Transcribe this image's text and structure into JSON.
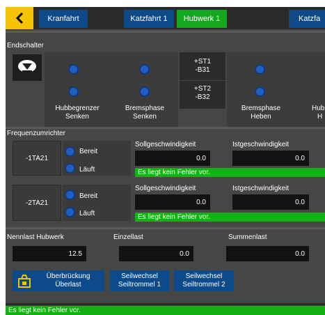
{
  "tabs": [
    {
      "label": "Kranfahrt",
      "active": false
    },
    {
      "label": "Katzfahrt 1",
      "active": false
    },
    {
      "label": "Hubwerk 1",
      "active": true
    },
    {
      "label": "Katzfa",
      "active": false
    }
  ],
  "endschalter": {
    "title": "Endschalter",
    "icon": "hook-down-icon",
    "st1": {
      "line1": "+ST1",
      "line2": "-B31"
    },
    "st2": {
      "line1": "+ST2",
      "line2": "-B32"
    },
    "columns": [
      {
        "line1": "Hubbegrenzer",
        "line2": "Senken"
      },
      {
        "line1": "Bremsphase",
        "line2": "Senken"
      },
      {
        "line1": "Bremsphase",
        "line2": "Heben"
      },
      {
        "line1": "Hubl",
        "line2": "H"
      }
    ]
  },
  "frequenzumrichter": {
    "title": "Frequenzumrichter",
    "units": [
      {
        "id": "-1TA21",
        "bereit": "Bereit",
        "laeuft": "Läuft",
        "soll_label": "Sollgeschwindigkeit",
        "soll_value": "0.0",
        "ist_label": "Istgeschwindigkeit",
        "ist_value": "0.0",
        "status": "Es liegt kein Fehler vor."
      },
      {
        "id": "-2TA21",
        "bereit": "Bereit",
        "laeuft": "Läuft",
        "soll_label": "Sollgeschwindigkeit",
        "soll_value": "0.0",
        "ist_label": "Istgeschwindigkeit",
        "ist_value": "0.0",
        "status": "Es liegt kein Fehler vor."
      }
    ]
  },
  "last": {
    "nennlast_label": "Nennlast Hubwerk",
    "nennlast_value": "12.5",
    "einzellast_label": "Einzellast",
    "einzellast_value": "0.0",
    "summenlast_label": "Summenlast",
    "summenlast_value": "0.0"
  },
  "buttons": {
    "ueberbrueckung": {
      "line1": "Überbrückung",
      "line2": "Überlast",
      "icon": "weight-icon"
    },
    "seilwechsel1": {
      "line1": "Seilwechsel",
      "line2": "Seiltrommel 1"
    },
    "seilwechsel2": {
      "line1": "Seilwechsel",
      "line2": "Seiltrommel 2"
    }
  },
  "footer_status": "Es liegt kein Fehler vor.",
  "colors": {
    "accent": "#f5c400",
    "tab": "#0d4a8a",
    "active_tab": "#14a81e",
    "ok": "#14b014",
    "led": "#1f5fc4"
  }
}
